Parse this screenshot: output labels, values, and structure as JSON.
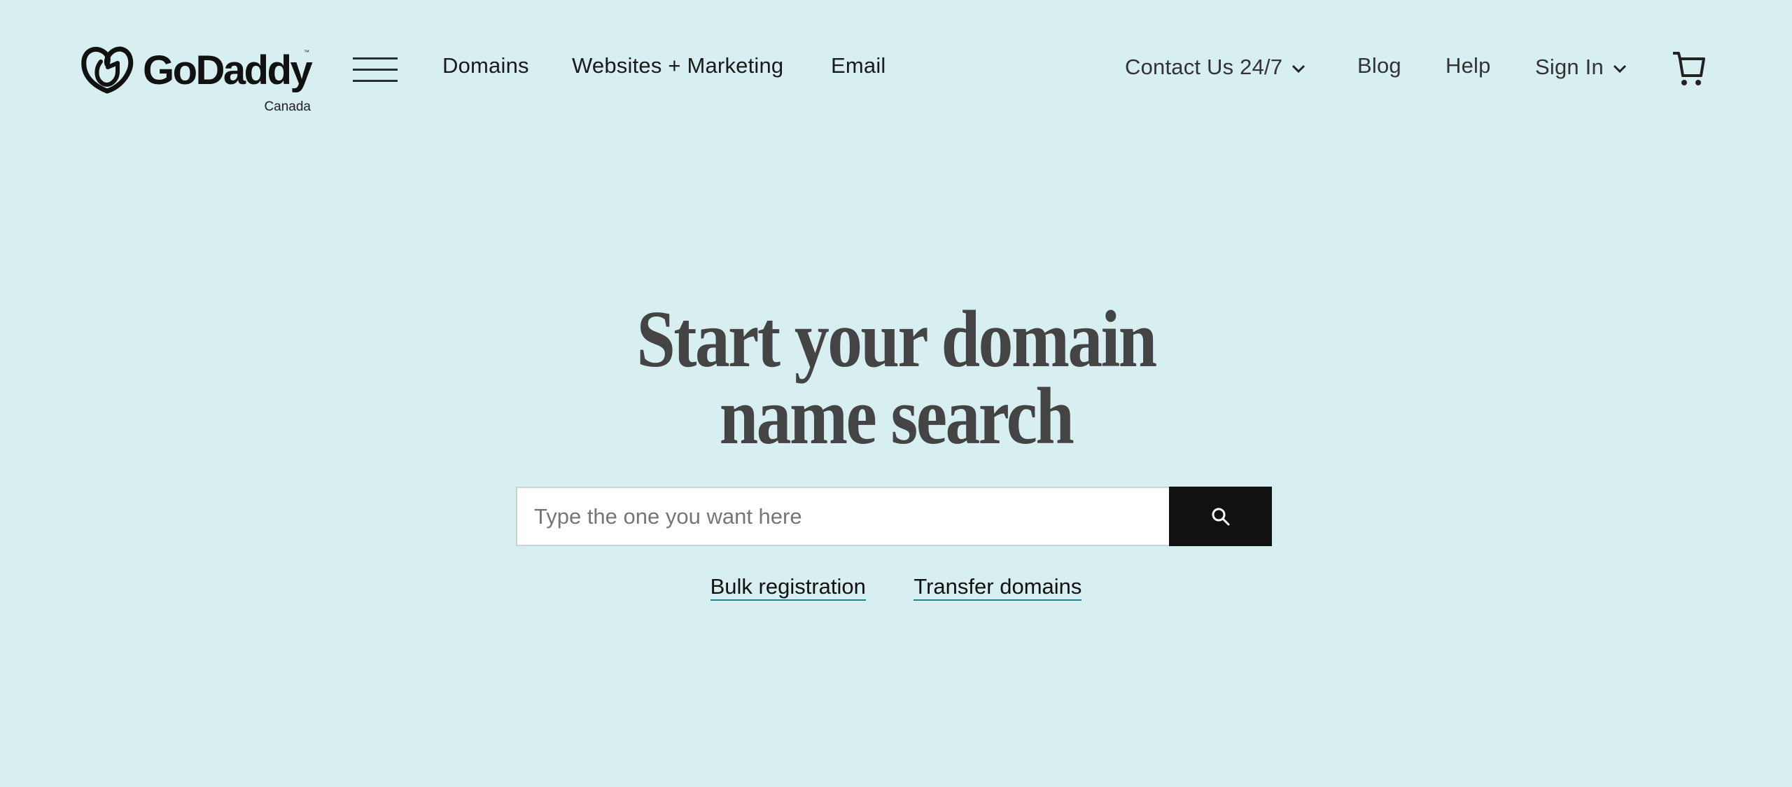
{
  "brand": {
    "name": "GoDaddy",
    "trademark": "™",
    "region": "Canada"
  },
  "nav": {
    "menu_icon": "hamburger-menu-icon",
    "left_links": [
      {
        "label": "Domains"
      },
      {
        "label": "Websites + Marketing"
      },
      {
        "label": "Email"
      }
    ],
    "right_links": [
      {
        "label": "Contact Us 24/7",
        "has_dropdown": true
      },
      {
        "label": "Blog",
        "has_dropdown": false
      },
      {
        "label": "Help",
        "has_dropdown": false
      },
      {
        "label": "Sign In",
        "has_dropdown": true
      }
    ],
    "cart_icon": "shopping-cart-icon"
  },
  "hero": {
    "title_line1": "Start your domain",
    "title_line2": "name search"
  },
  "search": {
    "value": "",
    "placeholder": "Type the one you want here",
    "button_icon": "search-icon"
  },
  "links": {
    "bulk": "Bulk registration",
    "transfer": "Transfer domains"
  },
  "colors": {
    "background": "#d7eff0",
    "text": "#111111",
    "headline": "#444444",
    "search_button": "#111111",
    "link_underline": "#1b8a8f"
  }
}
